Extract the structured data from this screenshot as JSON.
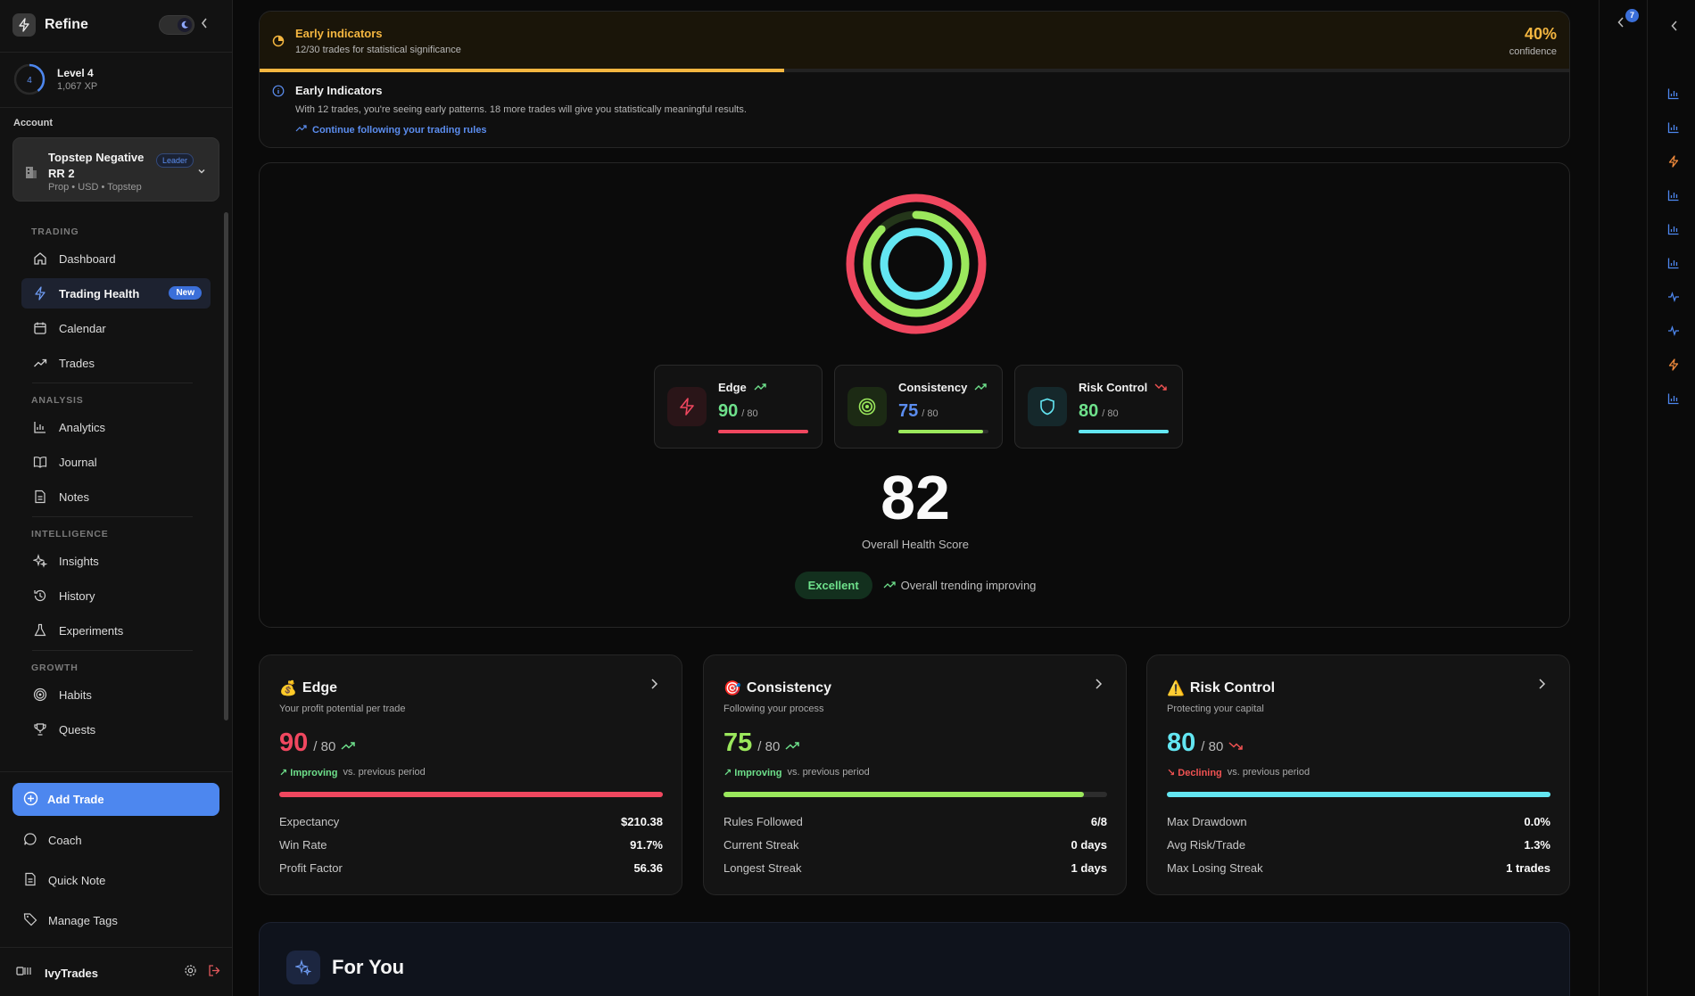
{
  "brand": {
    "name": "Refine"
  },
  "level": {
    "number": "4",
    "title": "Level 4",
    "xp": "1,067 XP"
  },
  "account": {
    "section_label": "Account",
    "name": "Topstep Negative RR 2",
    "badge": "Leader",
    "meta": "Prop • USD • Topstep"
  },
  "nav": {
    "trading_label": "TRADING",
    "analysis_label": "ANALYSIS",
    "intelligence_label": "INTELLIGENCE",
    "growth_label": "GROWTH",
    "items": {
      "dashboard": "Dashboard",
      "trading_health": "Trading Health",
      "new_badge": "New",
      "calendar": "Calendar",
      "trades": "Trades",
      "analytics": "Analytics",
      "journal": "Journal",
      "notes": "Notes",
      "insights": "Insights",
      "history": "History",
      "experiments": "Experiments",
      "habits": "Habits",
      "quests": "Quests"
    }
  },
  "actions": {
    "add_trade": "Add Trade",
    "coach": "Coach",
    "quick_note": "Quick Note",
    "manage_tags": "Manage Tags"
  },
  "user": {
    "name": "IvyTrades"
  },
  "indicator": {
    "title": "Early indicators",
    "subtitle": "12/30 trades for statistical significance",
    "confidence_value": "40%",
    "confidence_label": "confidence",
    "progress_fraction": 0.4,
    "info_title": "Early Indicators",
    "info_body": "With 12 trades, you're seeing early patterns. 18 more trades will give you statistically meaningful results.",
    "link": "Continue following your trading rules"
  },
  "health": {
    "metrics": [
      {
        "name": "Edge",
        "value": "90",
        "denominator": "/ 80",
        "color": "#f0475f",
        "fill": 1.0,
        "trend": "up"
      },
      {
        "name": "Consistency",
        "value": "75",
        "denominator": "/ 80",
        "color": "#9be85c",
        "fill": 0.94,
        "trend": "up"
      },
      {
        "name": "Risk Control",
        "value": "80",
        "denominator": "/ 80",
        "color": "#63e6f2",
        "fill": 1.0,
        "trend": "down"
      }
    ],
    "overall_score": "82",
    "overall_label": "Overall Health Score",
    "status": "Excellent",
    "trend_text": "Overall trending improving"
  },
  "details": [
    {
      "emoji": "💰",
      "title": "Edge",
      "subtitle": "Your profit potential per trade",
      "value": "90",
      "denominator": "/ 80",
      "color": "#f0475f",
      "trend_label": "↗ Improving",
      "trend_color": "#6ee08b",
      "trend_suffix": "vs. previous period",
      "fill": 1.0,
      "stats": [
        [
          "Expectancy",
          "$210.38"
        ],
        [
          "Win Rate",
          "91.7%"
        ],
        [
          "Profit Factor",
          "56.36"
        ]
      ]
    },
    {
      "emoji": "🎯",
      "title": "Consistency",
      "subtitle": "Following your process",
      "value": "75",
      "denominator": "/ 80",
      "color": "#9be85c",
      "trend_label": "↗ Improving",
      "trend_color": "#6ee08b",
      "trend_suffix": "vs. previous period",
      "fill": 0.94,
      "stats": [
        [
          "Rules Followed",
          "6/8"
        ],
        [
          "Current Streak",
          "0 days"
        ],
        [
          "Longest Streak",
          "1 days"
        ]
      ]
    },
    {
      "emoji": "⚠️",
      "title": "Risk Control",
      "subtitle": "Protecting your capital",
      "value": "80",
      "denominator": "/ 80",
      "color": "#63e6f2",
      "trend_label": "↘ Declining",
      "trend_color": "#f05252",
      "trend_suffix": "vs. previous period",
      "fill": 1.0,
      "stats": [
        [
          "Max Drawdown",
          "0.0%"
        ],
        [
          "Avg Risk/Trade",
          "1.3%"
        ],
        [
          "Max Losing Streak",
          "1 trades"
        ]
      ]
    }
  ],
  "for_you": {
    "title": "For You"
  },
  "rail": {
    "notification_count": "7"
  },
  "colors": {
    "accent": "#4d87ef",
    "warning": "#f4b640",
    "edge": "#f0475f",
    "consistency": "#9be85c",
    "risk": "#63e6f2"
  }
}
